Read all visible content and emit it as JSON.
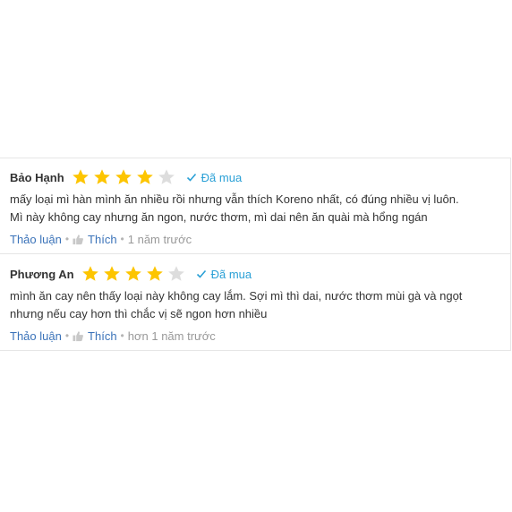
{
  "colors": {
    "star_filled": "#fdc500",
    "star_empty": "#dddddd",
    "bought": "#2aa0d6",
    "link": "#3b73b9",
    "muted": "#999999"
  },
  "reviews": [
    {
      "author": "Bảo Hạnh",
      "rating": 4,
      "max_rating": 5,
      "verified_label": "Đã mua",
      "content": [
        "mấy loại mì hàn mình ăn nhiều rồi nhưng vẫn thích Koreno nhất, có đúng nhiều vị luôn.",
        "Mì này không cay nhưng ăn ngon, nước thơm, mì dai nên ăn quài mà hổng ngán"
      ],
      "discuss_label": "Thảo luận",
      "like_label": "Thích",
      "time": "1 năm trước"
    },
    {
      "author": "Phương An",
      "rating": 4,
      "max_rating": 5,
      "verified_label": "Đã mua",
      "content": [
        "mình ăn cay nên thấy loại này không cay lắm. Sợi mì thì dai, nước thơm mùi gà và ngọt",
        "nhưng nếu cay hơn thì chắc vị sẽ ngon hơn nhiều"
      ],
      "discuss_label": "Thảo luận",
      "like_label": "Thích",
      "time": "hơn 1 năm trước"
    }
  ]
}
